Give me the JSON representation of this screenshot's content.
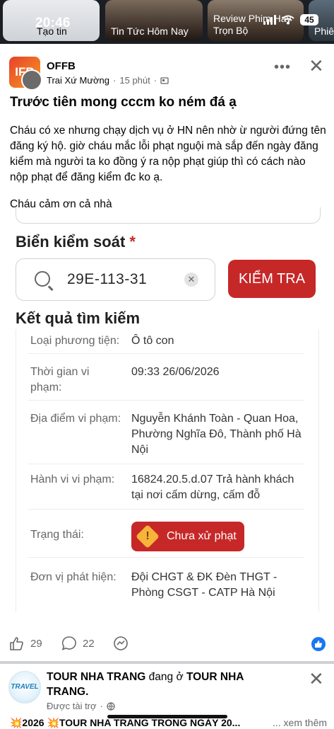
{
  "status_bar": {
    "time": "20:46",
    "battery": "45"
  },
  "stories": [
    {
      "label": "Tạo tin"
    },
    {
      "label": "Tin Tức Hôm Nay"
    },
    {
      "label": "Review Phim Hay Trọn Bộ"
    },
    {
      "label": "Phiê"
    }
  ],
  "post": {
    "page_name": "OFFB",
    "avatar_text": "IFB",
    "author": "Trai Xứ Mường",
    "time": "15 phút",
    "title": "Trước tiên mong cccm ko ném đá ạ",
    "body_1": "Cháu có xe nhưng chạy dịch vụ ở HN  nên nhờ ừ người đứng tên đăng ký hộ. giờ cháu mắc lỗi phạt nguội mà sắp đến ngày đăng kiểm mà người ta ko đồng ý ra nộp phạt giúp thì có cách nào nộp phạt để đăng kiểm đc ko ạ.",
    "body_2": "Cháu cảm ơn cả nhà",
    "likes": "29",
    "comments": "22"
  },
  "screenshot": {
    "plate_label": "Biển kiểm soát",
    "required_mark": "*",
    "plate_value": "29E-113-31",
    "check_button": "KIỂM TRA",
    "results_title": "Kết quả tìm kiếm",
    "rows": [
      {
        "key": "Loại phương tiện:",
        "value": "Ô tô con"
      },
      {
        "key": "Thời gian vi phạm:",
        "value": "09:33 26/06/2026"
      },
      {
        "key": "Địa điểm vi phạm:",
        "value": "Nguyễn Khánh Toàn - Quan Hoa, Phường Nghĩa Đô, Thành phố Hà Nội"
      },
      {
        "key": "Hành vi vi phạm:",
        "value": "16824.20.5.d.07 Trả hành khách tại nơi cấm dừng, cấm đỗ"
      },
      {
        "key": "Trạng thái:",
        "value": "Chưa xử phạt"
      },
      {
        "key": "Đơn vị phát hiện:",
        "value": "Đội CHGT & ĐK Đèn THGT - Phòng CSGT - CATP Hà Nội"
      }
    ]
  },
  "sponsored": {
    "page": "TOUR NHA TRANG",
    "connector": " đang ở ",
    "place": "TOUR NHA TRANG.",
    "label": "Được tài trợ",
    "avatar_text": "TRAVEL",
    "snippet": "💥2026 💥TOUR NHA TRANG TRONG NGÀY 20...",
    "see_more": "... xem thêm"
  },
  "colors": {
    "accent": "#1877f2",
    "danger": "#c62828",
    "warning": "#f6b43a"
  }
}
